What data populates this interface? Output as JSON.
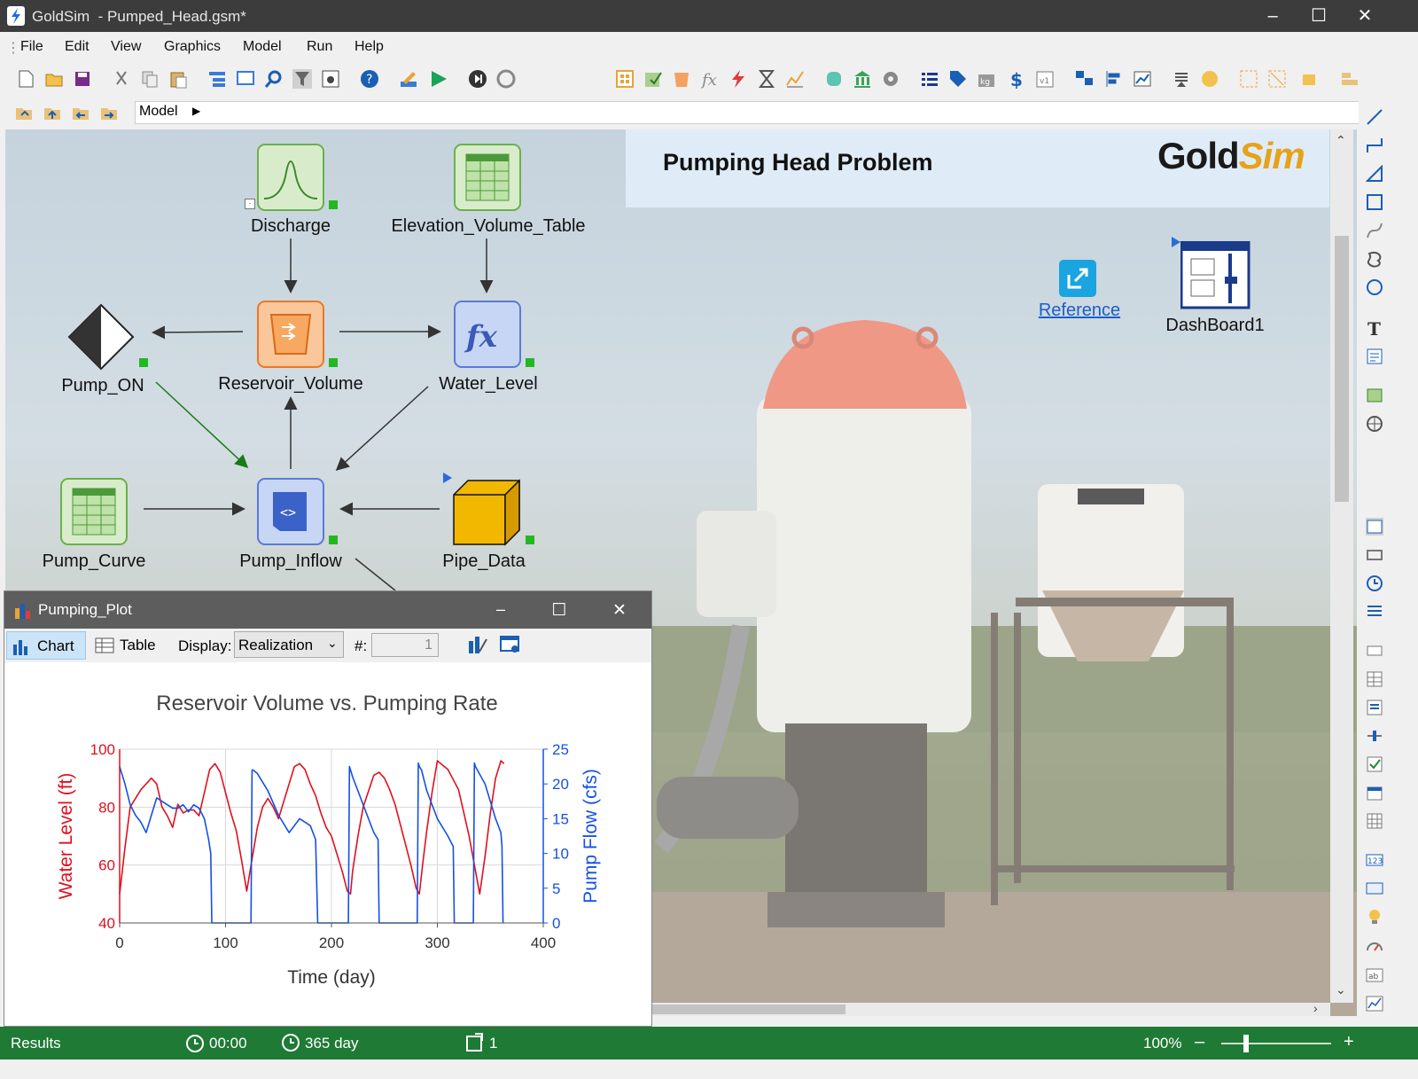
{
  "window": {
    "app_name": "GoldSim",
    "file_title": "- Pumped_Head.gsm*",
    "minimize": "–",
    "maximize": "☐",
    "close": "✕"
  },
  "menu": [
    "File",
    "Edit",
    "View",
    "Graphics",
    "Model",
    "Run",
    "Help"
  ],
  "breadcrumb": {
    "label": "Model",
    "arrow": "▶"
  },
  "canvas": {
    "banner_title": "Pumping Head Problem",
    "logo_gold": "Gold",
    "logo_sim": "Sim",
    "reference_label": "Reference",
    "dashboard_label": "DashBoard1",
    "elements": {
      "discharge": "Discharge",
      "elevation_volume_table": "Elevation_Volume_Table",
      "pump_on": "Pump_ON",
      "reservoir_volume": "Reservoir_Volume",
      "water_level": "Water_Level",
      "pump_curve": "Pump_Curve",
      "pump_inflow": "Pump_Inflow",
      "pipe_data": "Pipe_Data"
    },
    "fx_glyph": "fx",
    "code_glyph": "<>"
  },
  "plot_window": {
    "title": "Pumping_Plot",
    "tab_chart": "Chart",
    "tab_table": "Table",
    "display_label": "Display:",
    "display_value": "Realization",
    "number_label": "#:",
    "number_value": "1"
  },
  "colors": {
    "water_level": "#e0101e",
    "pump_flow": "#1450e6",
    "status_bar": "#1e7a35"
  },
  "chart_data": {
    "type": "line",
    "title": "Reservoir Volume vs. Pumping Rate",
    "xlabel": "Time (day)",
    "ylabel": "Water Level (ft)",
    "y2label": "Pump Flow (cfs)",
    "xlim": [
      0,
      400
    ],
    "ylim": [
      40,
      100
    ],
    "y2lim": [
      0,
      25
    ],
    "x_ticks": [
      "0",
      "100",
      "200",
      "300",
      "400"
    ],
    "y_ticks": [
      "40",
      "60",
      "80",
      "100"
    ],
    "y2_ticks": [
      "0",
      "5",
      "10",
      "15",
      "20",
      "25"
    ],
    "grid": true,
    "series": [
      {
        "name": "Water Level (ft)",
        "axis": "left",
        "x": [
          0,
          5,
          10,
          20,
          30,
          35,
          40,
          45,
          50,
          55,
          60,
          65,
          70,
          75,
          80,
          85,
          90,
          95,
          100,
          105,
          110,
          115,
          120,
          125,
          130,
          135,
          140,
          145,
          150,
          155,
          160,
          165,
          170,
          175,
          180,
          185,
          190,
          195,
          200,
          205,
          210,
          215,
          218,
          220,
          225,
          230,
          240,
          245,
          250,
          255,
          260,
          265,
          270,
          275,
          280,
          283,
          286,
          290,
          295,
          300,
          310,
          320,
          325,
          330,
          335,
          340,
          345,
          350,
          355,
          360,
          363
        ],
        "values": [
          50,
          66,
          80,
          86,
          90,
          88,
          80,
          77,
          73,
          81,
          78,
          79,
          79,
          77,
          85,
          93,
          95,
          92,
          85,
          78,
          72,
          62,
          51,
          62,
          73,
          80,
          83,
          80,
          76,
          82,
          88,
          94,
          95,
          93,
          88,
          84,
          78,
          73,
          70,
          64,
          58,
          51,
          50,
          58,
          70,
          80,
          91,
          92,
          90,
          86,
          81,
          74,
          67,
          60,
          52,
          50,
          60,
          72,
          85,
          96,
          93,
          86,
          78,
          70,
          60,
          50,
          63,
          78,
          90,
          96,
          95
        ]
      },
      {
        "name": "Pump Flow (cfs)",
        "axis": "right",
        "x": [
          0,
          5,
          10,
          15,
          20,
          25,
          30,
          35,
          40,
          45,
          50,
          55,
          60,
          65,
          70,
          75,
          80,
          84,
          86,
          87,
          88,
          90,
          100,
          110,
          120,
          124,
          125,
          126,
          130,
          140,
          150,
          160,
          170,
          180,
          185,
          187,
          188,
          189,
          195,
          210,
          216,
          217,
          218,
          220,
          225,
          230,
          240,
          244,
          245,
          246,
          255,
          270,
          281,
          282,
          283,
          285,
          290,
          300,
          310,
          315,
          316,
          317,
          330,
          334,
          335,
          336,
          345,
          355,
          360,
          361,
          362
        ],
        "values": [
          22.5,
          20,
          17,
          15.5,
          14.5,
          13,
          15.5,
          18,
          17.5,
          17,
          16.5,
          16.5,
          17,
          16,
          17,
          16.5,
          15,
          12,
          10,
          0,
          0,
          0,
          0,
          0,
          0,
          0,
          22,
          22,
          21.5,
          19,
          15.5,
          13,
          15,
          14,
          12,
          0,
          0,
          0,
          0,
          0,
          0,
          22.5,
          22,
          21,
          19,
          17,
          13,
          12,
          0,
          0,
          0,
          0,
          0,
          23,
          22.5,
          22,
          19,
          15,
          12.5,
          11,
          0,
          0,
          0,
          0,
          23,
          22.5,
          20,
          15,
          13,
          11,
          0
        ]
      }
    ]
  },
  "status": {
    "mode": "Results",
    "clock": "00:00",
    "duration": "365 day",
    "realization": "1",
    "zoom": "100%",
    "zoom_minus": "–",
    "zoom_plus": "+"
  }
}
